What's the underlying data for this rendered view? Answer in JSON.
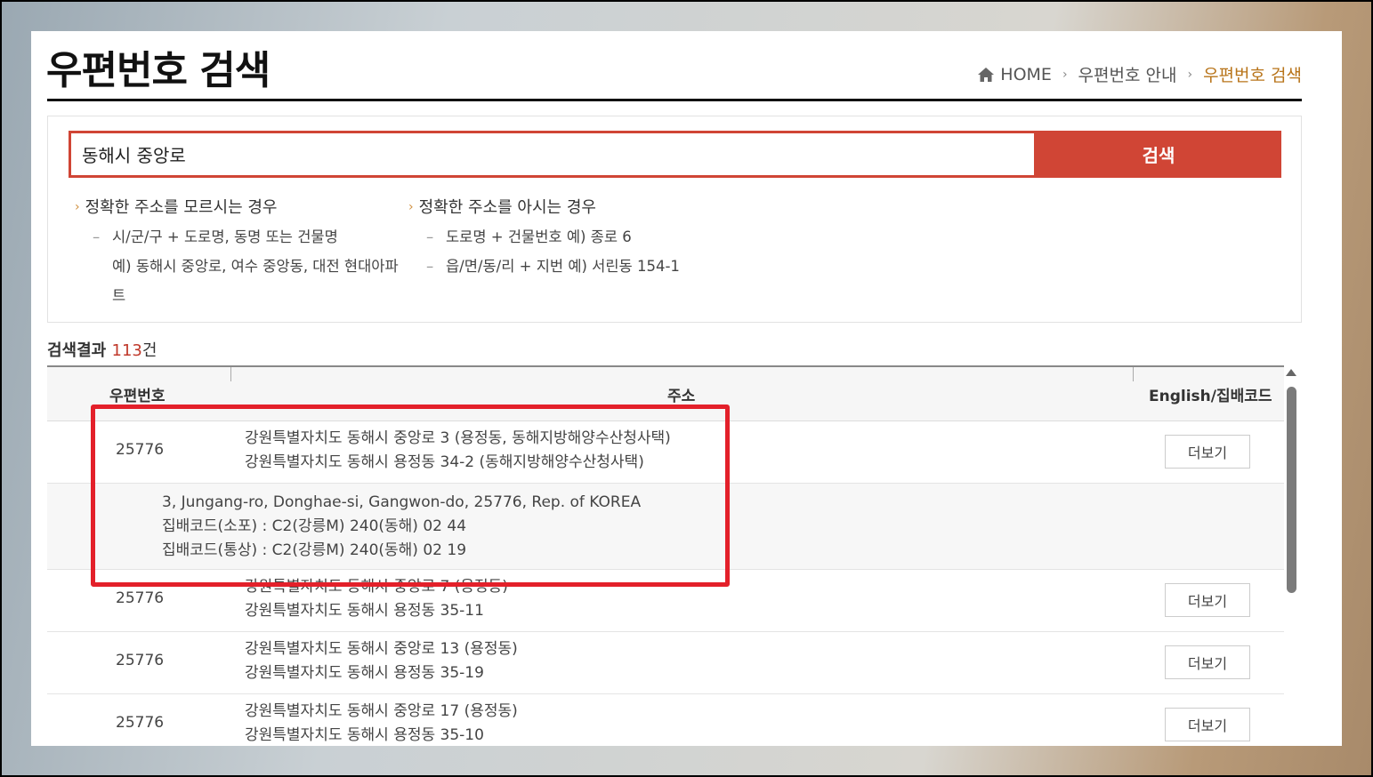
{
  "header": {
    "title": "우편번호 검색",
    "breadcrumb": [
      "HOME",
      "우편번호 안내",
      "우편번호 검색"
    ]
  },
  "search": {
    "value": "동해시 중앙로",
    "button_label": "검색"
  },
  "guide": {
    "left": {
      "heading": "정확한 주소를 모르시는 경우",
      "line1": "시/군/구 + 도로명, 동명 또는 건물명",
      "line2": "예) 동해시 중앙로, 여수 중앙동, 대전 현대아파",
      "line3": "트"
    },
    "right": {
      "heading": "정확한 주소를 아시는 경우",
      "line1": "도로명 + 건물번호 예) 종로 6",
      "line2": "읍/면/동/리 + 지번 예) 서린동 154-1"
    }
  },
  "results": {
    "label": "검색결과",
    "count": "113",
    "suffix": "건",
    "columns": {
      "zip": "우편번호",
      "address": "주소",
      "english": "English/집배코드"
    },
    "more_label": "더보기",
    "rows": [
      {
        "zip": "25776",
        "road": "강원특별자치도 동해시 중앙로 3 (용정동, 동해지방해양수산청사택)",
        "jibun": "강원특별자치도 동해시 용정동 34-2 (동해지방해양수산청사택)",
        "english": "3, Jungang-ro, Donghae-si, Gangwon-do, 25776, Rep. of KOREA",
        "code_sopo": "집배코드(소포) : C2(강릉M) 240(동해) 02 44",
        "code_tongsang": "집배코드(통상) : C2(강릉M) 240(동해) 02 19"
      },
      {
        "zip": "25776",
        "road": "강원특별자치도 동해시 중앙로 7 (용정동)",
        "jibun": "강원특별자치도 동해시 용정동 35-11"
      },
      {
        "zip": "25776",
        "road": "강원특별자치도 동해시 중앙로 13 (용정동)",
        "jibun": "강원특별자치도 동해시 용정동 35-19"
      },
      {
        "zip": "25776",
        "road": "강원특별자치도 동해시 중앙로 17 (용정동)",
        "jibun": "강원특별자치도 동해시 용정동 35-10"
      }
    ]
  },
  "colors": {
    "accent": "#d04535",
    "breadcrumb_current": "#b8741a",
    "count": "#c0392b",
    "highlight": "#e3202a"
  }
}
